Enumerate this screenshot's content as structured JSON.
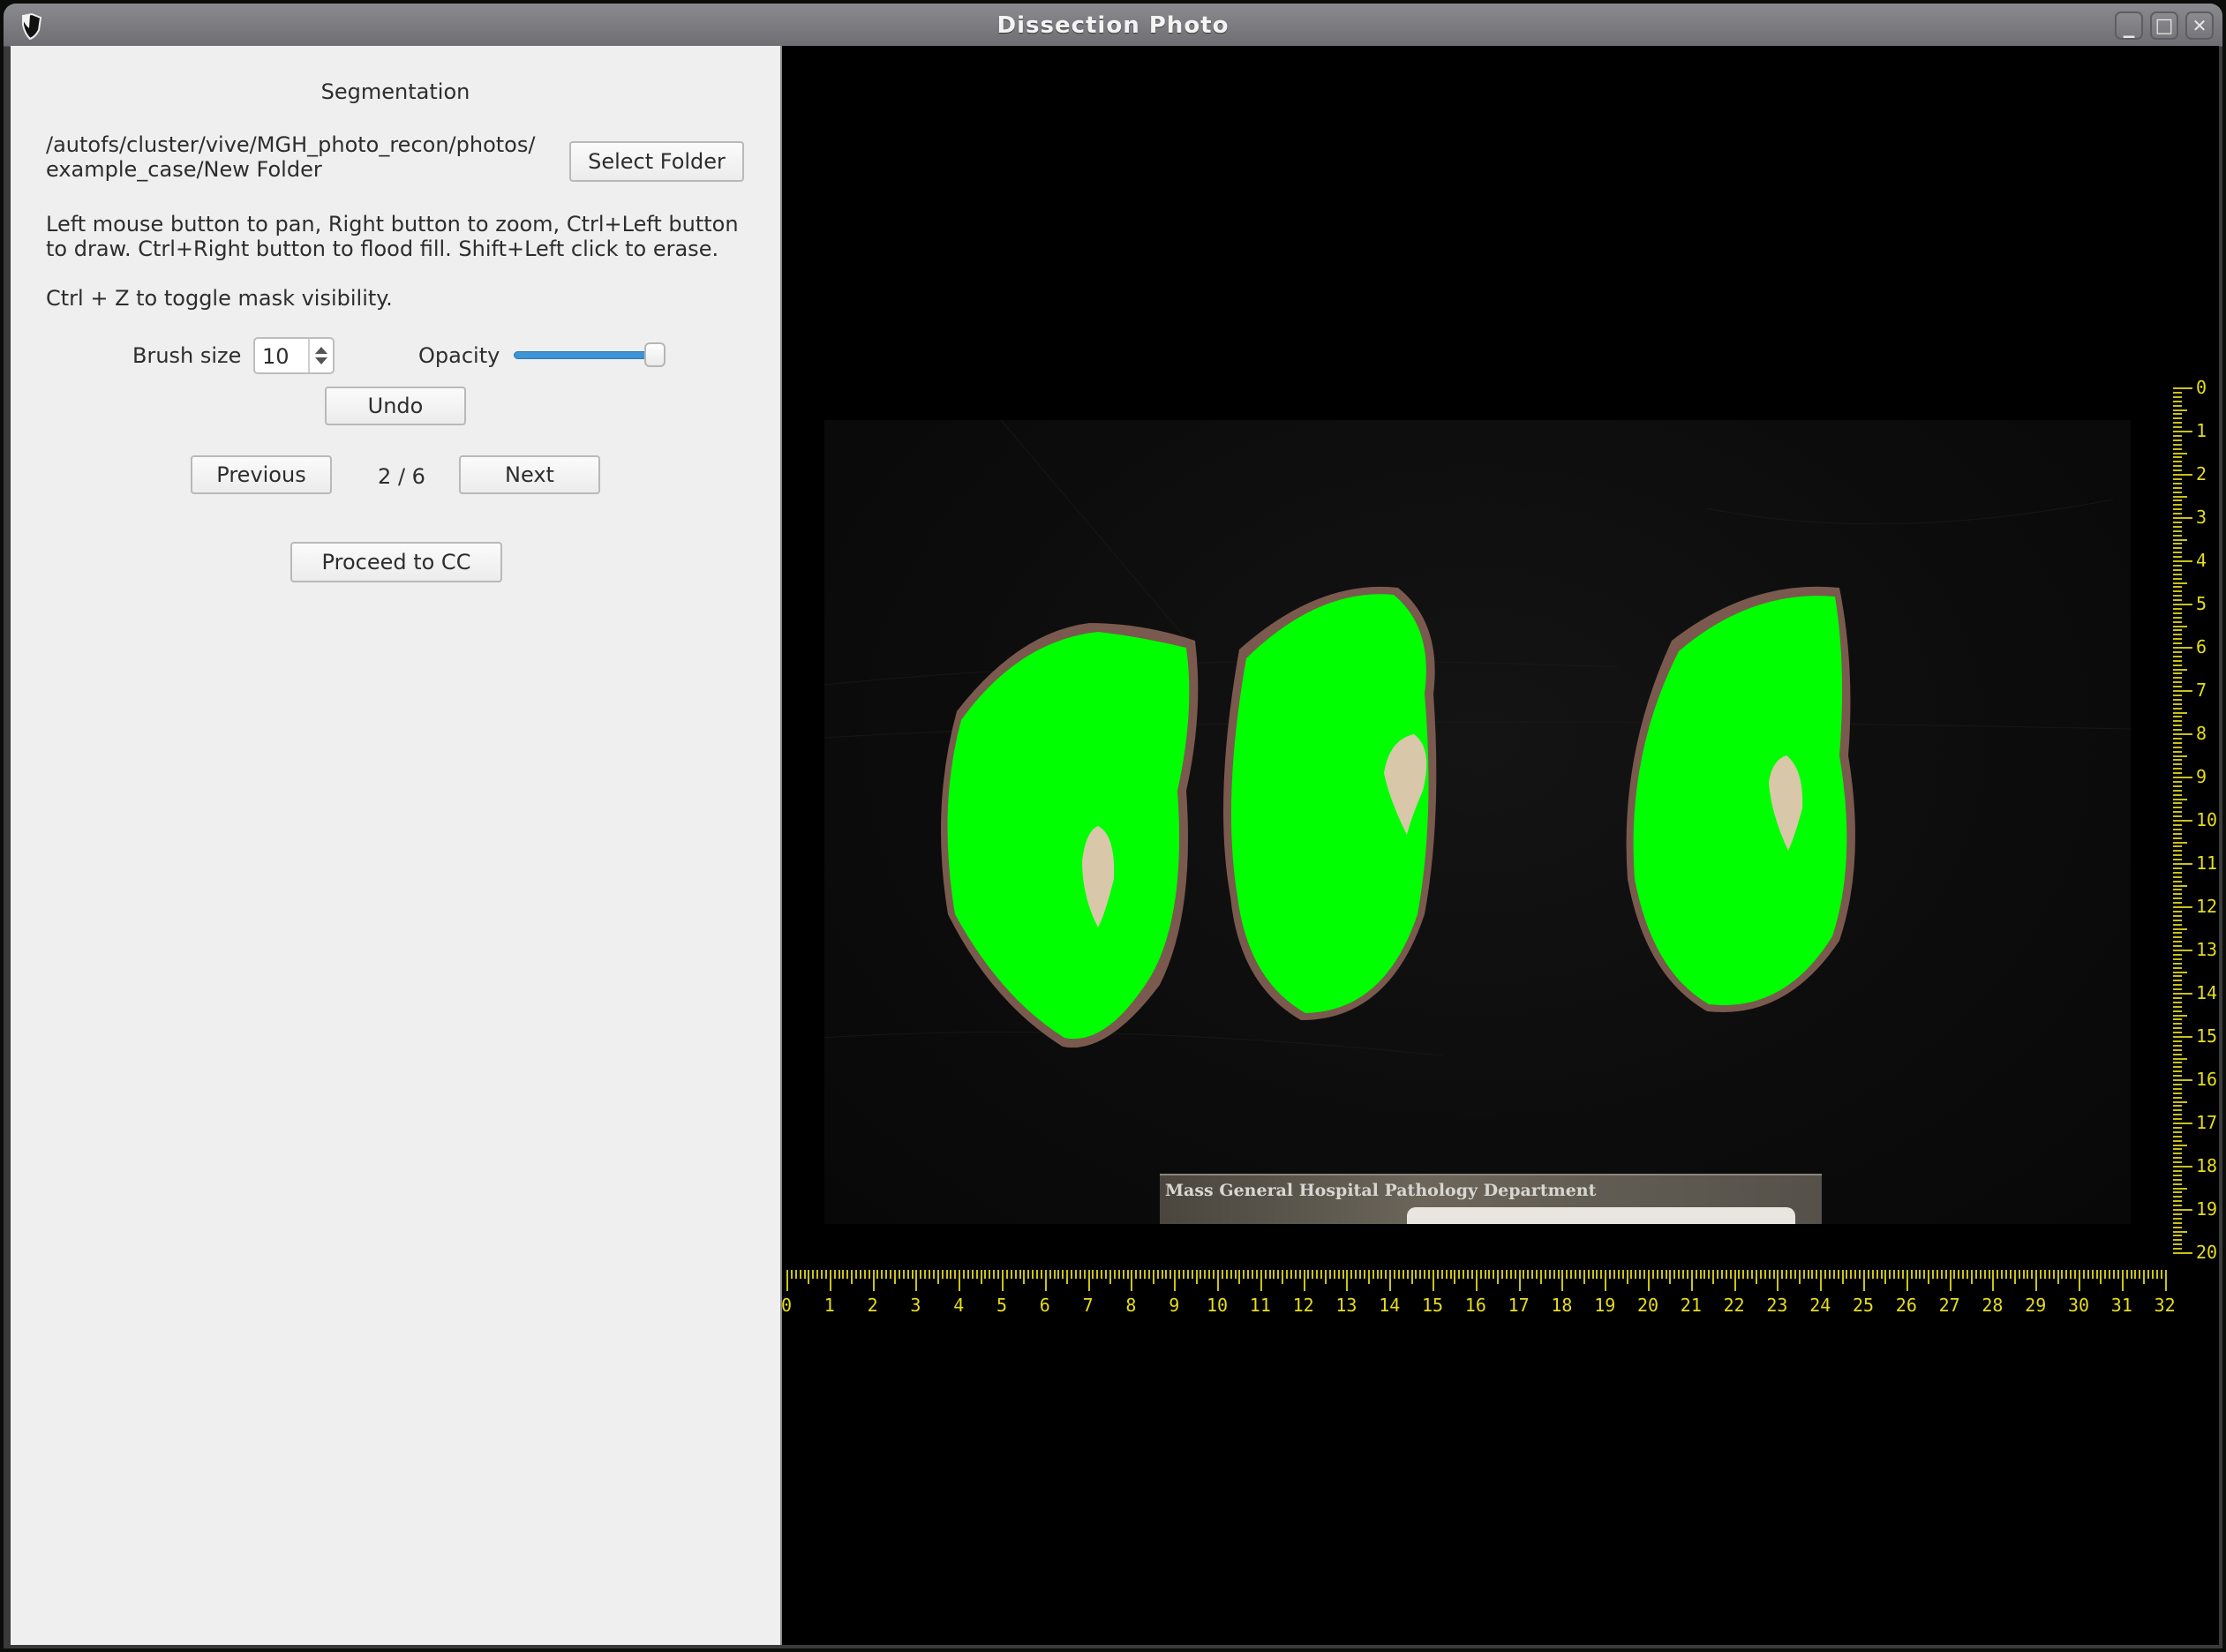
{
  "window": {
    "title": "Dissection Photo",
    "app_icon": "shield-icon",
    "controls": [
      {
        "name": "minimize",
        "icon": "minimize-icon",
        "glyph": "▁"
      },
      {
        "name": "maximize",
        "icon": "maximize-icon",
        "glyph": "□"
      },
      {
        "name": "close",
        "icon": "close-icon",
        "glyph": "✕"
      }
    ]
  },
  "panel": {
    "title": "Segmentation",
    "folder_path_line1": "/autofs/cluster/vive/MGH_photo_recon/photos/",
    "folder_path_line2": "example_case/New Folder",
    "select_folder_label": "Select Folder",
    "instructions_line1": "Left mouse button to pan, Right button to zoom, Ctrl+Left button",
    "instructions_line2": "to draw. Ctrl+Right button to flood fill. Shift+Left click to erase.",
    "mask_hint": "Ctrl + Z to toggle mask visibility.",
    "brush_size_label": "Brush size",
    "brush_size_value": "10",
    "opacity_label": "Opacity",
    "opacity_value": 1.0,
    "undo_label": "Undo",
    "previous_label": "Previous",
    "page_indicator": "2 / 6",
    "current_page": 2,
    "total_pages": 6,
    "next_label": "Next",
    "proceed_label": "Proceed to CC"
  },
  "viewer": {
    "mask_color": "#00ff00",
    "ruler_color": "#e6dd1c",
    "photo_label_text": "Mass General Hospital Pathology Department",
    "vertical_ruler": {
      "min": 0,
      "max": 20,
      "labels": [
        "0",
        "1",
        "2",
        "3",
        "4",
        "5",
        "6",
        "7",
        "8",
        "9",
        "10",
        "11",
        "12",
        "13",
        "14",
        "15",
        "16",
        "17",
        "18",
        "19",
        "20"
      ]
    },
    "horizontal_ruler": {
      "min": 0,
      "max": 32,
      "labels": [
        "0",
        "1",
        "2",
        "3",
        "4",
        "5",
        "6",
        "7",
        "8",
        "9",
        "10",
        "11",
        "12",
        "13",
        "14",
        "15",
        "16",
        "17",
        "18",
        "19",
        "20",
        "21",
        "22",
        "23",
        "24",
        "25",
        "26",
        "27",
        "28",
        "29",
        "30",
        "31",
        "32"
      ]
    }
  }
}
